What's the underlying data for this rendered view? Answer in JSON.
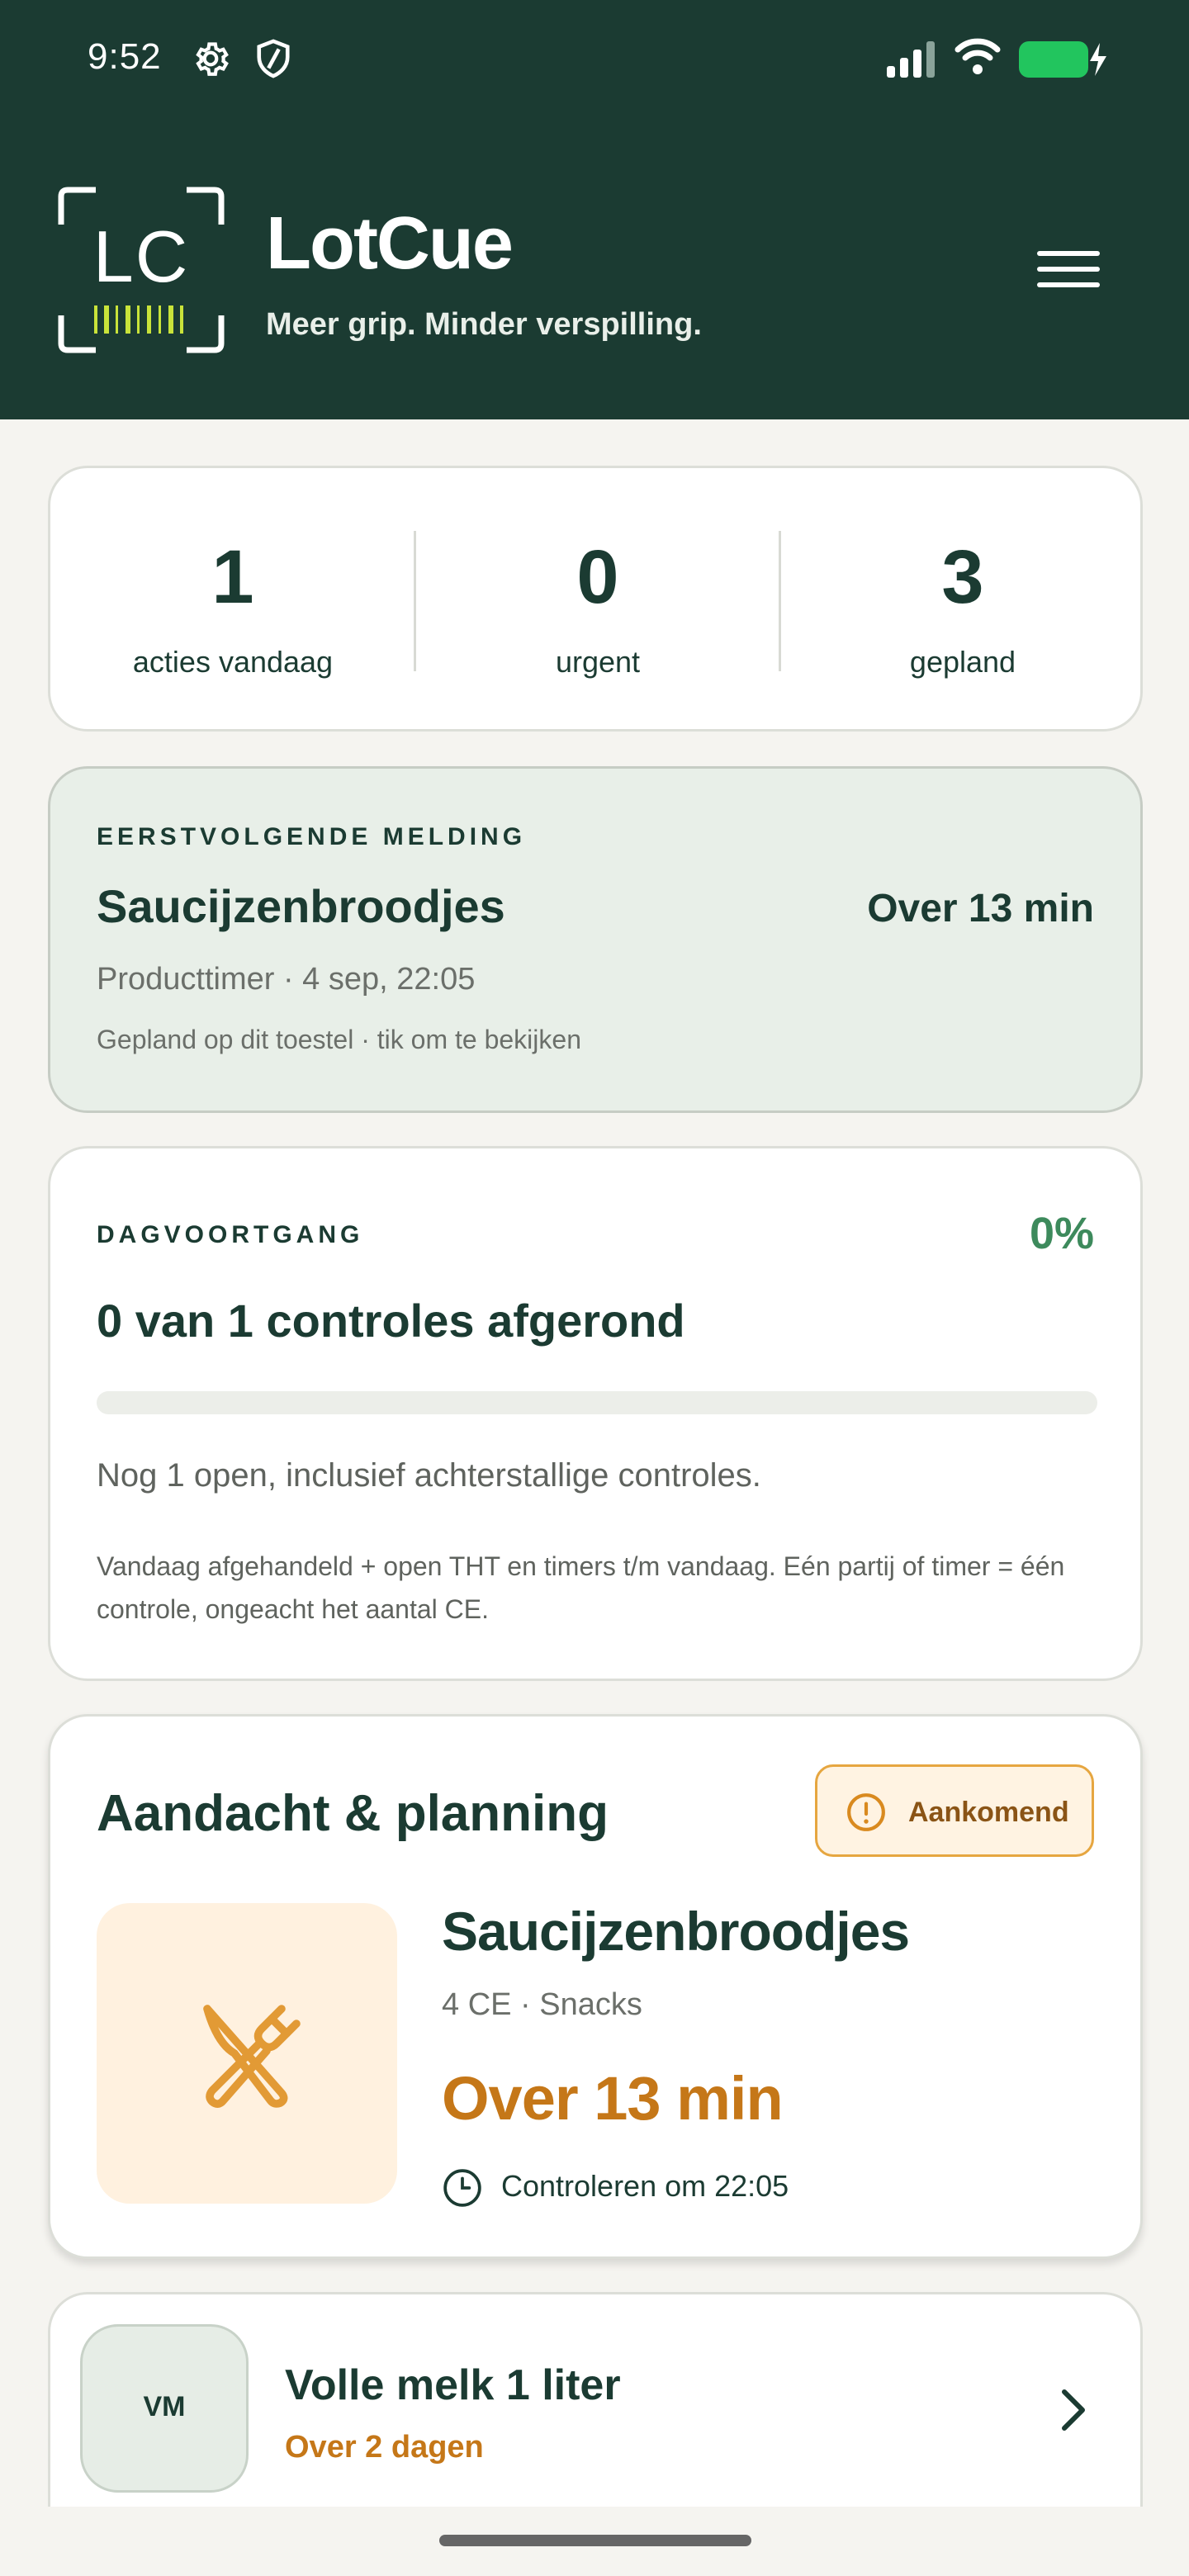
{
  "status_bar": {
    "time": "9:52",
    "icons": [
      "gear-icon",
      "shield-icon",
      "signal-icon",
      "wifi-icon",
      "battery-charging-icon"
    ],
    "battery_color": "#22c55e"
  },
  "header": {
    "logo_text": "LC",
    "app_name": "LotCue",
    "tagline": "Meer grip. Minder verspilling.",
    "background": "#1b3b32"
  },
  "stats": [
    {
      "value": "1",
      "label": "acties vandaag"
    },
    {
      "value": "0",
      "label": "urgent"
    },
    {
      "value": "3",
      "label": "gepland"
    }
  ],
  "next_notification": {
    "eyebrow": "EERSTVOLGENDE MELDING",
    "title": "Saucijzenbroodjes",
    "time": "Over 13 min",
    "subtitle": "Producttimer · 4 sep, 22:05",
    "note": "Gepland op dit toestel · tik om te bekijken"
  },
  "day_progress": {
    "eyebrow": "DAGVOORTGANG",
    "percent_label": "0%",
    "progress_fraction": 0,
    "title": "0 van 1 controles afgerond",
    "open_text": "Nog 1 open, inclusief achterstallige controles.",
    "note": "Vandaag afgehandeld + open THT en timers t/m vandaag. Eén partij of timer = één controle, ongeacht het aantal CE.",
    "accent": "#3d8a5c"
  },
  "attention": {
    "title": "Aandacht & planning",
    "badge_label": "Aankomend",
    "item": {
      "icon": "utensils-icon",
      "name": "Saucijzenbroodjes",
      "meta": "4 CE · Snacks",
      "due": "Over 13 min",
      "check_label": "Controleren om 22:05"
    },
    "accent": "#c57718"
  },
  "list": [
    {
      "initials": "VM",
      "name": "Volle melk 1 liter",
      "due": "Over 2 dagen"
    }
  ]
}
